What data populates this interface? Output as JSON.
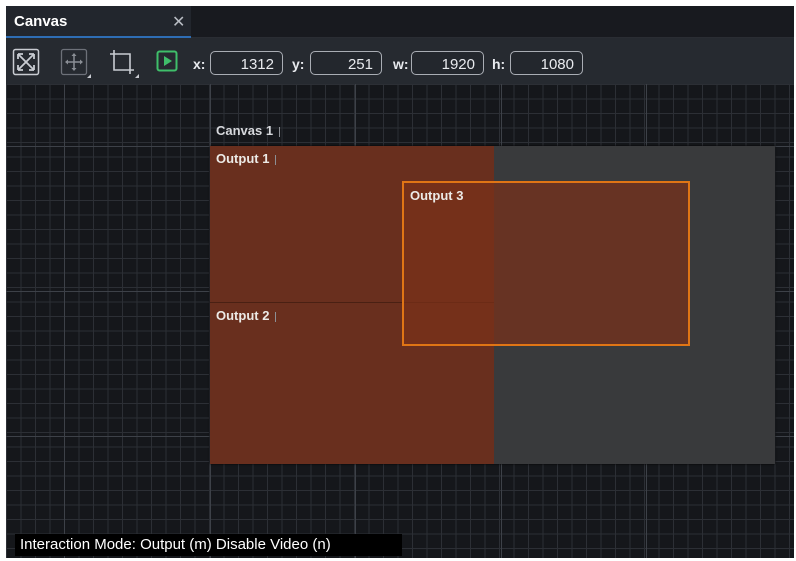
{
  "tab": {
    "title": "Canvas",
    "close_glyph": "✕"
  },
  "toolbar": {
    "tools": [
      {
        "name": "fit-view-icon"
      },
      {
        "name": "move-icon"
      },
      {
        "name": "crop-icon"
      },
      {
        "name": "play-icon",
        "color": "#3fbf6a"
      }
    ],
    "fields": {
      "x": {
        "label": "x:",
        "value": "1312"
      },
      "y": {
        "label": "y:",
        "value": "251"
      },
      "w": {
        "label": "w:",
        "value": "1920"
      },
      "h": {
        "label": "h:",
        "value": "1080"
      }
    }
  },
  "canvas": {
    "label": "Canvas 1",
    "outputs": [
      {
        "label": "Output 1"
      },
      {
        "label": "Output 2"
      },
      {
        "label": "Output 3",
        "selected": true
      }
    ]
  },
  "status": {
    "text": "Interaction Mode: Output (m) Disable Video (n)"
  },
  "colors": {
    "accent": "#2e6db4",
    "selection": "#e07515",
    "output_fill": "#702e1a"
  }
}
